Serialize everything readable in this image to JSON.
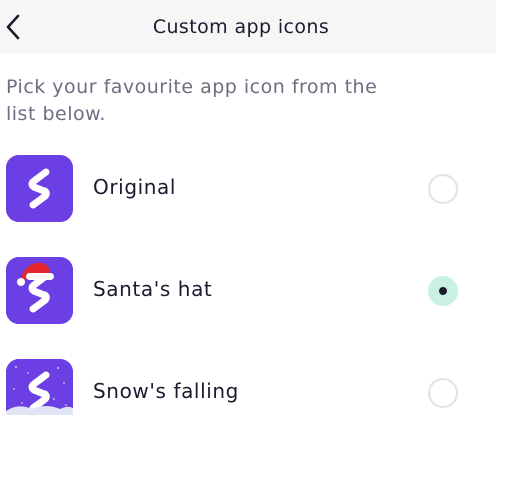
{
  "header": {
    "title": "Custom app icons",
    "back_icon": "chevron-left-icon"
  },
  "description": "Pick your favourite app icon from the list below.",
  "options": [
    {
      "label": "Original",
      "icon": "app-icon-original",
      "selected": false
    },
    {
      "label": "Santa's hat",
      "icon": "app-icon-santas-hat",
      "selected": true
    },
    {
      "label": "Snow's falling",
      "icon": "app-icon-snows-falling",
      "selected": false
    }
  ],
  "colors": {
    "brand_purple": "#6b3fe3",
    "selected_radio": "#c8f1e4",
    "text_primary": "#1b1a2e",
    "text_secondary": "#6f6d80"
  }
}
